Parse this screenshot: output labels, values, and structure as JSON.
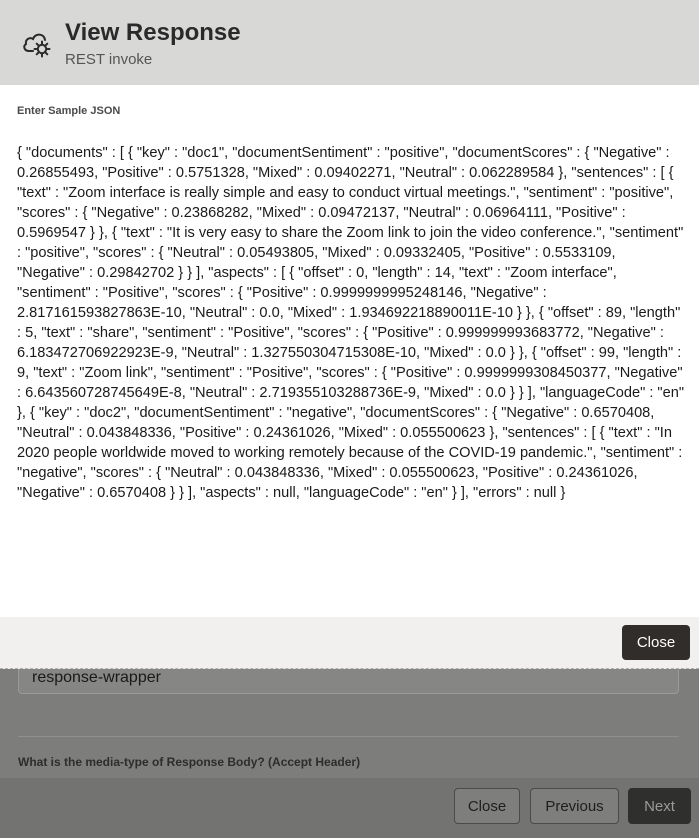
{
  "modal": {
    "title": "View Response",
    "subtitle": "REST invoke",
    "field_label": "Enter Sample JSON",
    "json_content": "{ \"documents\" : [ { \"key\" : \"doc1\", \"documentSentiment\" : \"positive\", \"documentScores\" : { \"Negative\" : 0.26855493, \"Positive\" : 0.5751328, \"Mixed\" : 0.09402271, \"Neutral\" : 0.062289584 }, \"sentences\" : [ { \"text\" : \"Zoom interface is really simple and easy to conduct virtual meetings.\", \"sentiment\" : \"positive\", \"scores\" : { \"Negative\" : 0.23868282, \"Mixed\" : 0.09472137, \"Neutral\" : 0.06964111, \"Positive\" : 0.5969547 } }, { \"text\" : \"It is very easy to share the Zoom link to join the video conference.\", \"sentiment\" : \"positive\", \"scores\" : { \"Neutral\" : 0.05493805, \"Mixed\" : 0.09332405, \"Positive\" : 0.5533109, \"Negative\" : 0.29842702 } } ], \"aspects\" : [ { \"offset\" : 0, \"length\" : 14, \"text\" : \"Zoom interface\", \"sentiment\" : \"Positive\", \"scores\" : { \"Positive\" : 0.9999999995248146, \"Negative\" : 2.817161593827863E-10, \"Neutral\" : 0.0, \"Mixed\" : 1.934692218890011E-10 } }, { \"offset\" : 89, \"length\" : 5, \"text\" : \"share\", \"sentiment\" : \"Positive\", \"scores\" : { \"Positive\" : 0.999999993683772, \"Negative\" : 6.183472706922923E-9, \"Neutral\" : 1.327550304715308E-10, \"Mixed\" : 0.0 } }, { \"offset\" : 99, \"length\" : 9, \"text\" : \"Zoom link\", \"sentiment\" : \"Positive\", \"scores\" : { \"Positive\" : 0.9999999308450377, \"Negative\" : 6.643560728745649E-8, \"Neutral\" : 2.719355103288736E-9, \"Mixed\" : 0.0 } } ], \"languageCode\" : \"en\" }, { \"key\" : \"doc2\", \"documentSentiment\" : \"negative\", \"documentScores\" : { \"Negative\" : 0.6570408, \"Neutral\" : 0.043848336, \"Positive\" : 0.24361026, \"Mixed\" : 0.055500623 }, \"sentences\" : [ { \"text\" : \"In 2020 people worldwide moved to working remotely because of the COVID-19 pandemic.\", \"sentiment\" : \"negative\", \"scores\" : { \"Neutral\" : 0.043848336, \"Mixed\" : 0.055500623, \"Positive\" : 0.24361026, \"Negative\" : 0.6570408 } } ], \"aspects\" : null, \"languageCode\" : \"en\" } ], \"errors\" : null }",
    "close_label": "Close",
    "icon": "cloud-gear-icon"
  },
  "background": {
    "input_value": "response-wrapper",
    "question": "What is the media-type of Response Body? (Accept Header)",
    "buttons": {
      "close_label": "Close",
      "previous_label": "Previous",
      "next_label": "Next"
    }
  },
  "colors": {
    "primary_button": "#312d2a",
    "header_bg": "#d8d8d7",
    "overlay": "#7d7d7b"
  }
}
